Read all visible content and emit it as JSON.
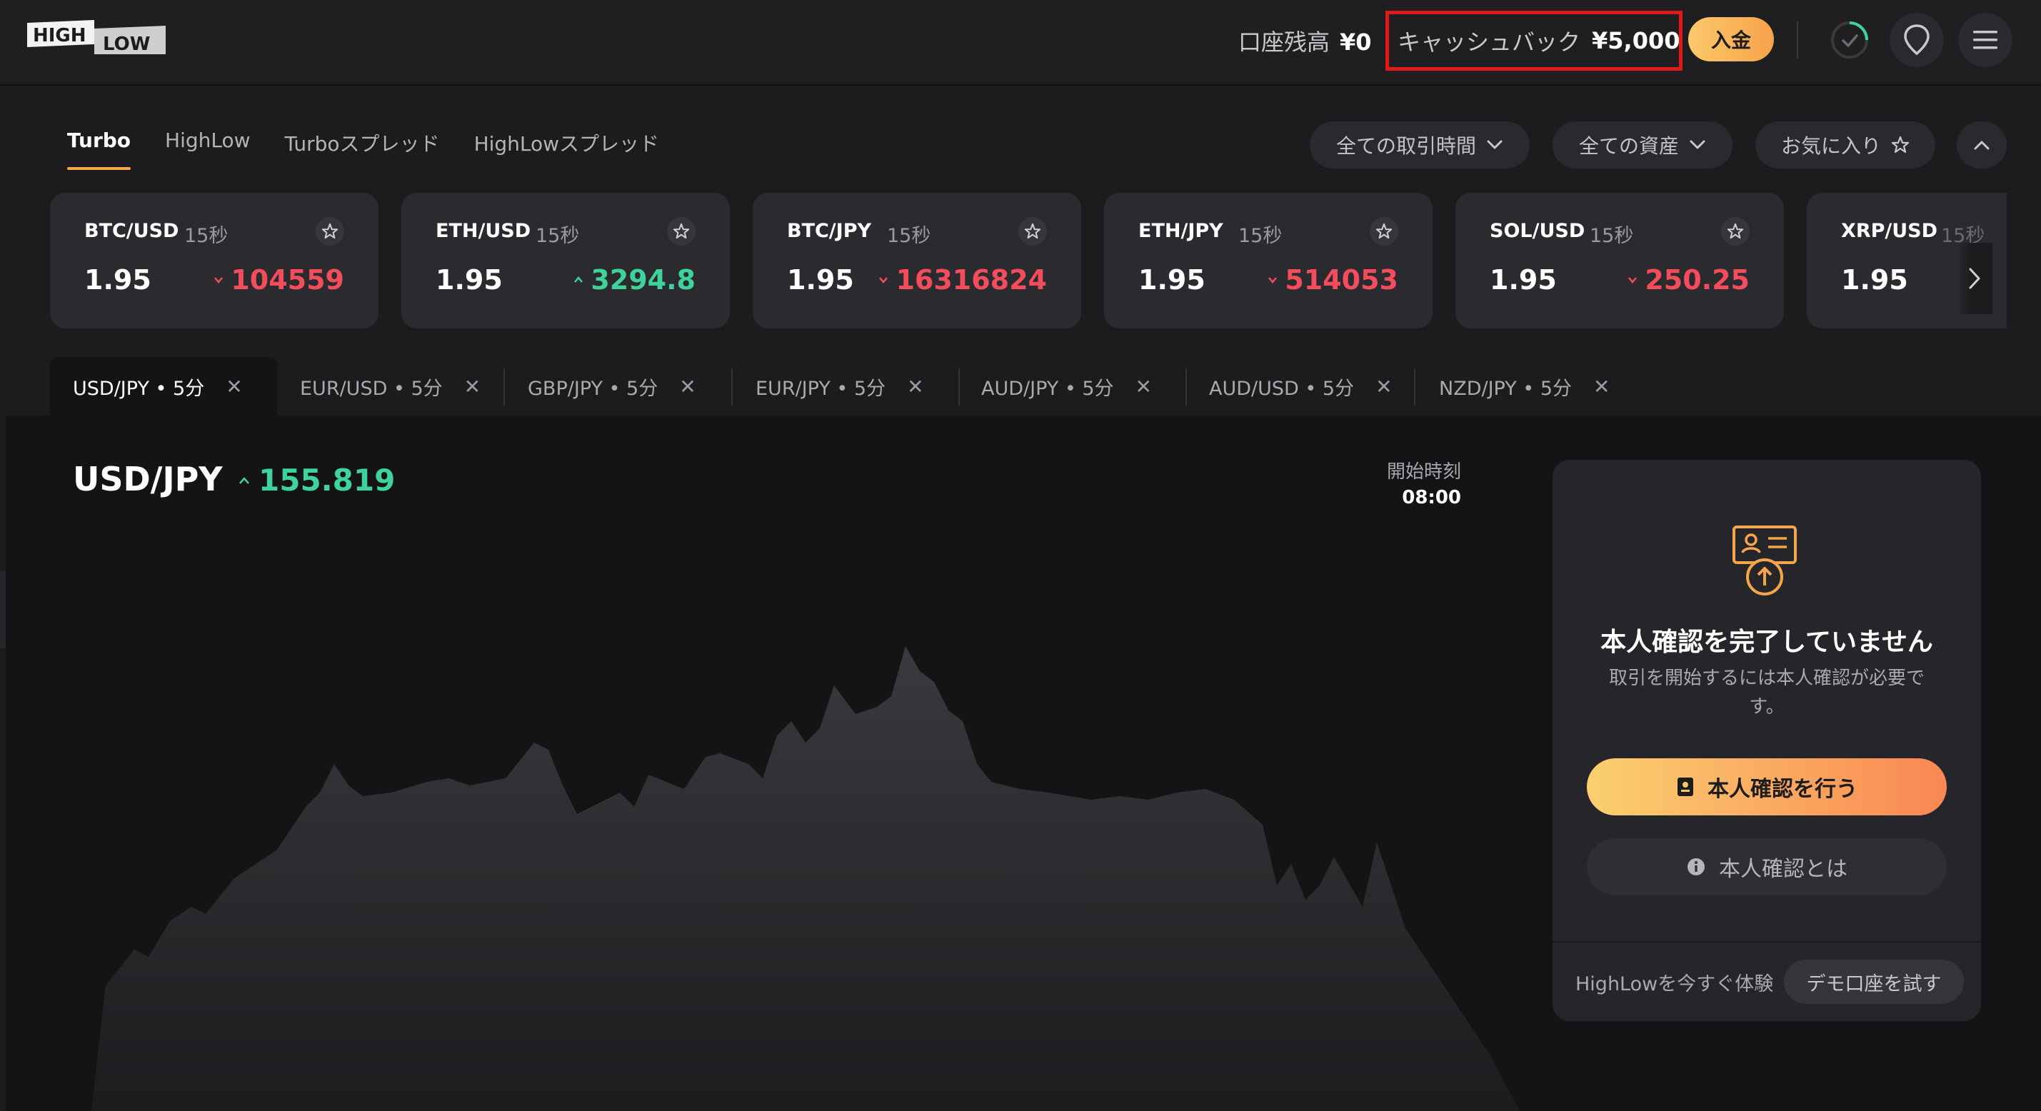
{
  "header": {
    "logo_text": "HIGH LOW",
    "balance_label": "口座残高",
    "balance_value": "¥0",
    "cashback_label": "キャッシュバック",
    "cashback_value": "¥5,000",
    "deposit_label": "入金",
    "icons": [
      "progress-check-icon",
      "location-pin-icon",
      "menu-icon"
    ]
  },
  "product_tabs": [
    "Turbo",
    "HighLow",
    "Turboスプレッド",
    "HighLowスプレッド"
  ],
  "active_product_tab": "Turbo",
  "filters": {
    "time": "全ての取引時間",
    "assets": "全ての資産",
    "favorites": "お気に入り"
  },
  "asset_cards": [
    {
      "pair": "BTC/USD",
      "duration": "15秒",
      "payout": "1.95",
      "price": "104559",
      "direction": "down"
    },
    {
      "pair": "ETH/USD",
      "duration": "15秒",
      "payout": "1.95",
      "price": "3294.8",
      "direction": "up"
    },
    {
      "pair": "BTC/JPY",
      "duration": "15秒",
      "payout": "1.95",
      "price": "16316824",
      "direction": "down"
    },
    {
      "pair": "ETH/JPY",
      "duration": "15秒",
      "payout": "1.95",
      "price": "514053",
      "direction": "down"
    },
    {
      "pair": "SOL/USD",
      "duration": "15秒",
      "payout": "1.95",
      "price": "250.25",
      "direction": "down"
    },
    {
      "pair": "XRP/USD",
      "duration": "15秒",
      "payout": "1.95",
      "price": "",
      "direction": "down"
    }
  ],
  "chart_tabs": [
    "USD/JPY • 5分",
    "EUR/USD • 5分",
    "GBP/JPY • 5分",
    "EUR/JPY • 5分",
    "AUD/JPY • 5分",
    "AUD/USD • 5分",
    "NZD/JPY • 5分"
  ],
  "chart": {
    "pair": "USD/JPY",
    "price": "155.819",
    "direction": "up",
    "start_label": "開始時刻",
    "start_time": "08:00"
  },
  "kyc": {
    "title": "本人確認を完了していません",
    "description": "取引を開始するには本人確認が必要です。",
    "primary_button": "本人確認を行う",
    "secondary_button": "本人確認とは",
    "demo_text": "HighLowを今すぐ体験",
    "demo_button": "デモ口座を試す"
  },
  "colors": {
    "accent": "#f5a54b",
    "up": "#3ed39a",
    "down": "#f34d5d",
    "highlight_border": "#e01818"
  }
}
